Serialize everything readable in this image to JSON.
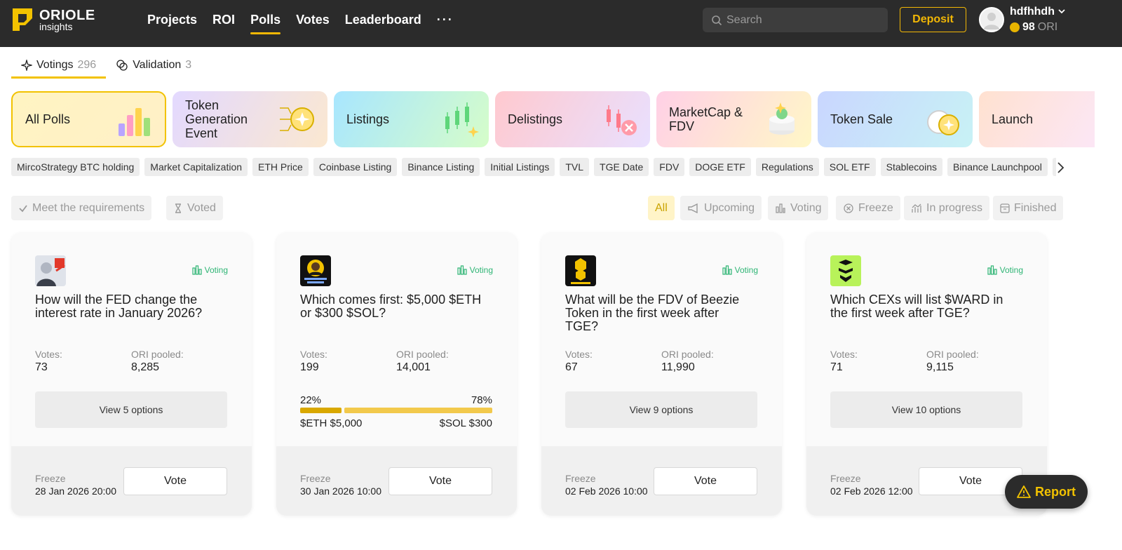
{
  "header": {
    "logo_text": "ORIOLE",
    "logo_sub": "insights",
    "nav": [
      "Projects",
      "ROI",
      "Polls",
      "Votes",
      "Leaderboard"
    ],
    "nav_active": "Polls",
    "more_label": "···",
    "search_placeholder": "Search",
    "deposit_label": "Deposit",
    "username": "hdfhhdh",
    "balance_value": "98",
    "balance_unit": "ORI"
  },
  "tabs": [
    {
      "label": "Votings",
      "count": "296"
    },
    {
      "label": "Validation",
      "count": "3"
    }
  ],
  "categories": [
    "All Polls",
    "Token Generation Event",
    "Listings",
    "Delistings",
    "MarketCap & FDV",
    "Token Sale",
    "Launch"
  ],
  "tags": [
    "MircoStrategy BTC holding",
    "Market Capitalization",
    "ETH Price",
    "Coinbase Listing",
    "Binance Listing",
    "Initial Listings",
    "TVL",
    "TGE Date",
    "FDV",
    "DOGE ETF",
    "Regulations",
    "SOL ETF",
    "Stablecoins",
    "Binance Launchpool",
    "A"
  ],
  "filters_left": [
    "Meet the requirements",
    "Voted"
  ],
  "filters_right": [
    "All",
    "Upcoming",
    "Voting",
    "Freeze",
    "In progress",
    "Finished"
  ],
  "cards": [
    {
      "status": "Voting",
      "question": "How will the FED change the interest rate in January 2026?",
      "votes_label": "Votes:",
      "votes": "73",
      "pooled_label": "ORI pooled:",
      "pooled": "8,285",
      "options_label": "View 5 options",
      "freeze_label": "Freeze",
      "freeze_date": "28 Jan 2026 20:00",
      "vote_label": "Vote"
    },
    {
      "status": "Voting",
      "question": "Which comes first: $5,000 $ETH or $300 $SOL?",
      "votes_label": "Votes:",
      "votes": "199",
      "pooled_label": "ORI pooled:",
      "pooled": "14,001",
      "pct_a": "22%",
      "pct_b": "78%",
      "share_a": 0.22,
      "opt_a": "$ETH $5,000",
      "opt_b": "$SOL $300",
      "freeze_label": "Freeze",
      "freeze_date": "30 Jan 2026 10:00",
      "vote_label": "Vote"
    },
    {
      "status": "Voting",
      "question": "What will be the FDV of Beezie Token in the first week after TGE?",
      "votes_label": "Votes:",
      "votes": "67",
      "pooled_label": "ORI pooled:",
      "pooled": "11,990",
      "options_label": "View 9 options",
      "freeze_label": "Freeze",
      "freeze_date": "02 Feb 2026 10:00",
      "vote_label": "Vote"
    },
    {
      "status": "Voting",
      "question": "Which CEXs will list $WARD in the first week after TGE?",
      "votes_label": "Votes:",
      "votes": "71",
      "pooled_label": "ORI pooled:",
      "pooled": "9,115",
      "options_label": "View 10 options",
      "freeze_label": "Freeze",
      "freeze_date": "02 Feb 2026 12:00",
      "vote_label": "Vote"
    }
  ],
  "report_label": "Report",
  "colors": {
    "accent": "#f2c200",
    "header_bg": "#2b2b2b",
    "voting_green": "#2fb575"
  }
}
